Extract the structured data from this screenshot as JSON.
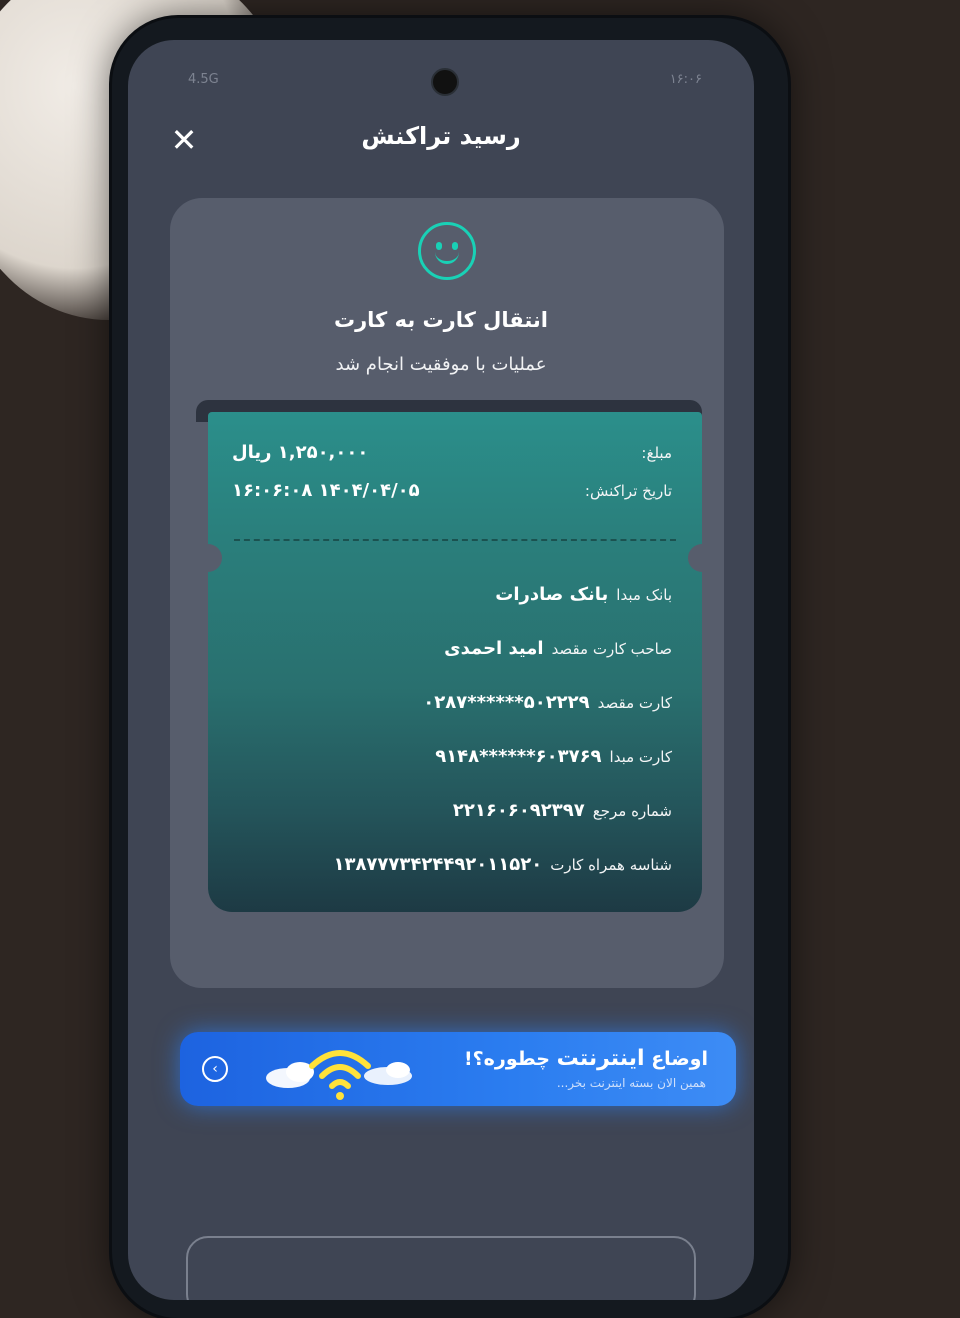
{
  "status_bar": {
    "left": "4.5G",
    "right": "۱۶:۰۶"
  },
  "header": {
    "title": "رسید تراکنش",
    "close_symbol": "✕"
  },
  "receipt": {
    "type": "انتقال کارت به کارت",
    "status": "عملیات با موفقیت انجام شد",
    "amount_label": "مبلغ:",
    "amount_value": "۱,۲۵۰,۰۰۰ ریال",
    "date_label": "تاریخ تراکنش:",
    "date_value": "۱۴۰۴/۰۴/۰۵ ۱۶:۰۶:۰۸",
    "details": [
      {
        "label": "بانک مبدا",
        "value": "بانک صادرات"
      },
      {
        "label": "صاحب کارت مقصد",
        "value": "امید احمدی"
      },
      {
        "label": "کارت مقصد",
        "value": "۵۰۲۲۲۹******۰۲۸۷"
      },
      {
        "label": "کارت مبدا",
        "value": "۶۰۳۷۶۹******۹۱۴۸"
      },
      {
        "label": "شماره مرجع",
        "value": "۲۲۱۶۰۶۰۹۲۳۹۷"
      },
      {
        "label": "شناسه همراه کارت",
        "value": "۱۳۸۷۷۷۳۴۲۴۴۹۲۰۱۱۵۲۰"
      }
    ]
  },
  "promo": {
    "title_prefix": "اوضاع",
    "title_accent": "اینترنتت",
    "title_suffix": "چطوره؟!",
    "subtitle": "همین الان بسته اینترنت بخر...",
    "arrow_symbol": "‹"
  },
  "colors": {
    "accent": "#19d1b6",
    "promo_blue": "#2b7df0"
  }
}
